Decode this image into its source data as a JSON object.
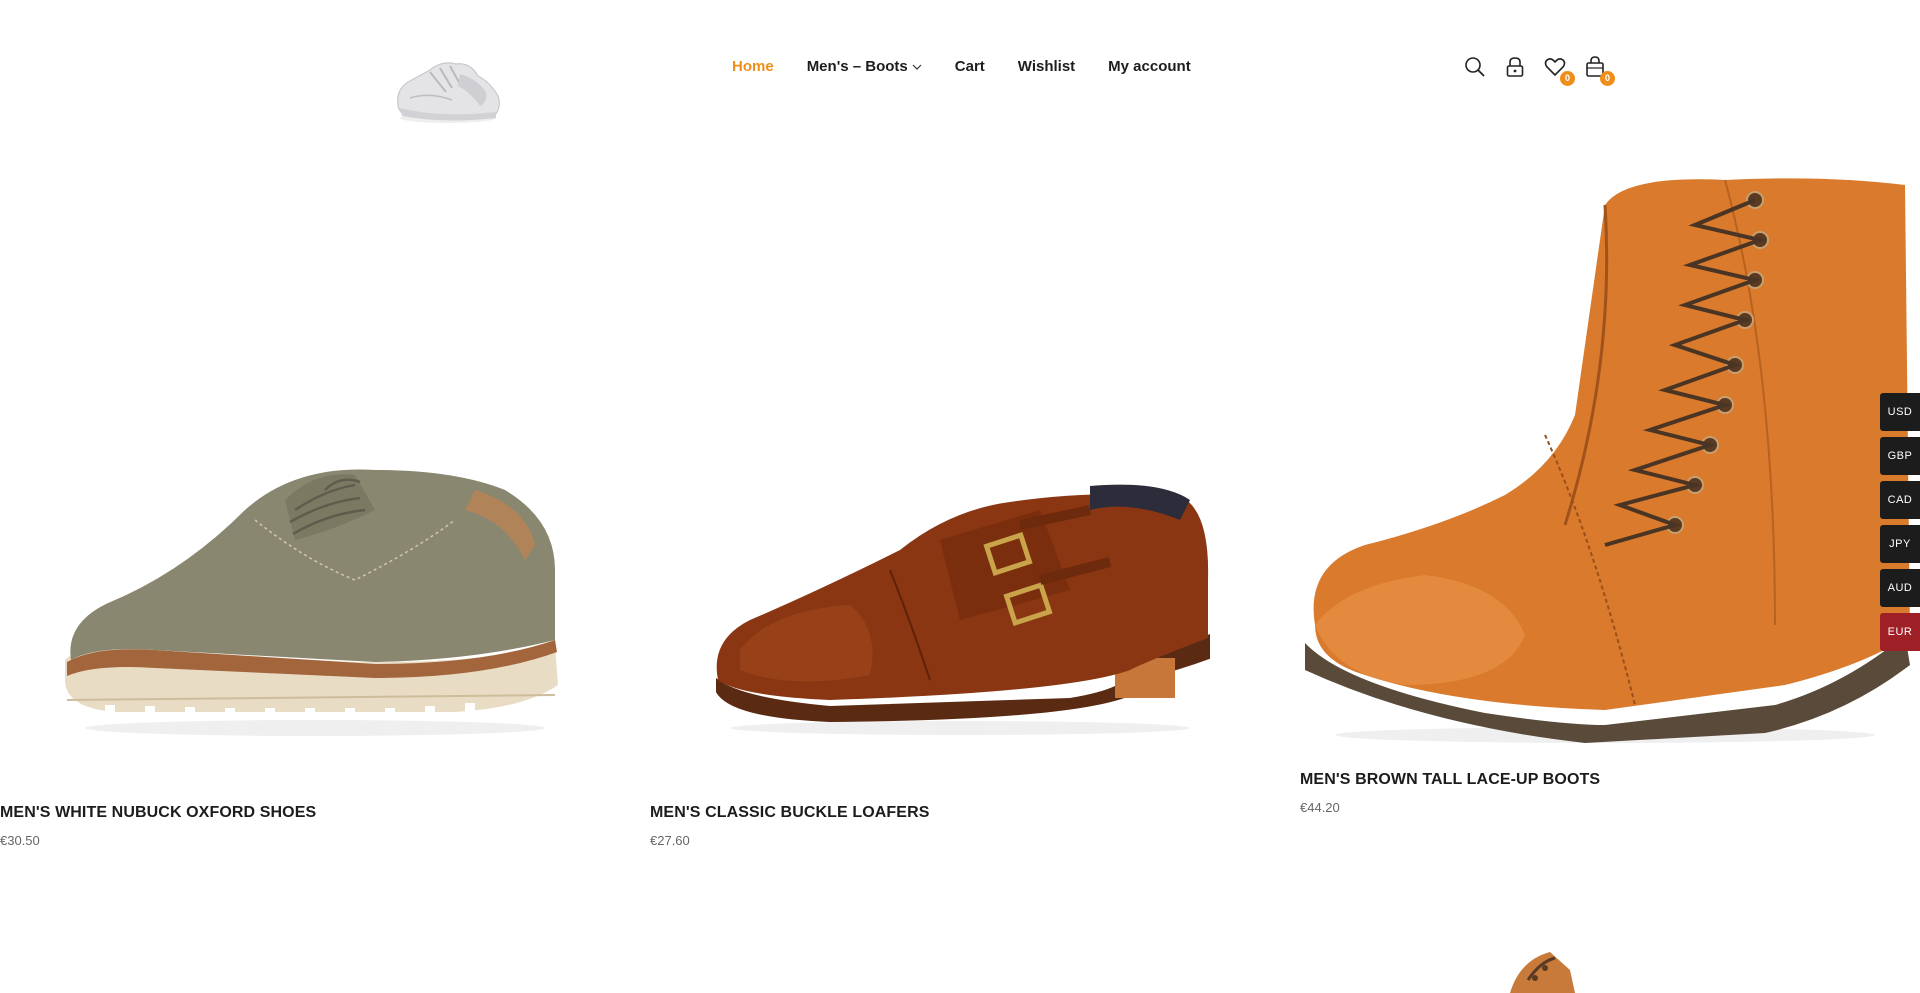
{
  "nav": {
    "items": [
      {
        "label": "Home",
        "active": true
      },
      {
        "label": "Men's – Boots",
        "has_dropdown": true
      },
      {
        "label": "Cart"
      },
      {
        "label": "Wishlist"
      },
      {
        "label": "My account"
      }
    ]
  },
  "header_icons": {
    "wishlist_count": "0",
    "cart_count": "0"
  },
  "products": [
    {
      "title": "MEN'S WHITE NUBUCK OXFORD SHOES",
      "price": "€30.50"
    },
    {
      "title": "MEN'S CLASSIC BUCKLE LOAFERS",
      "price": "€27.60"
    },
    {
      "title": "MEN'S BROWN TALL LACE-UP BOOTS",
      "price": "€44.20"
    }
  ],
  "currencies": [
    {
      "code": "USD"
    },
    {
      "code": "GBP"
    },
    {
      "code": "CAD"
    },
    {
      "code": "JPY"
    },
    {
      "code": "AUD"
    },
    {
      "code": "EUR",
      "active": true
    }
  ],
  "colors": {
    "accent": "#ef8f1a",
    "active_currency": "#9e1f26",
    "dark": "#1c1c1c"
  }
}
